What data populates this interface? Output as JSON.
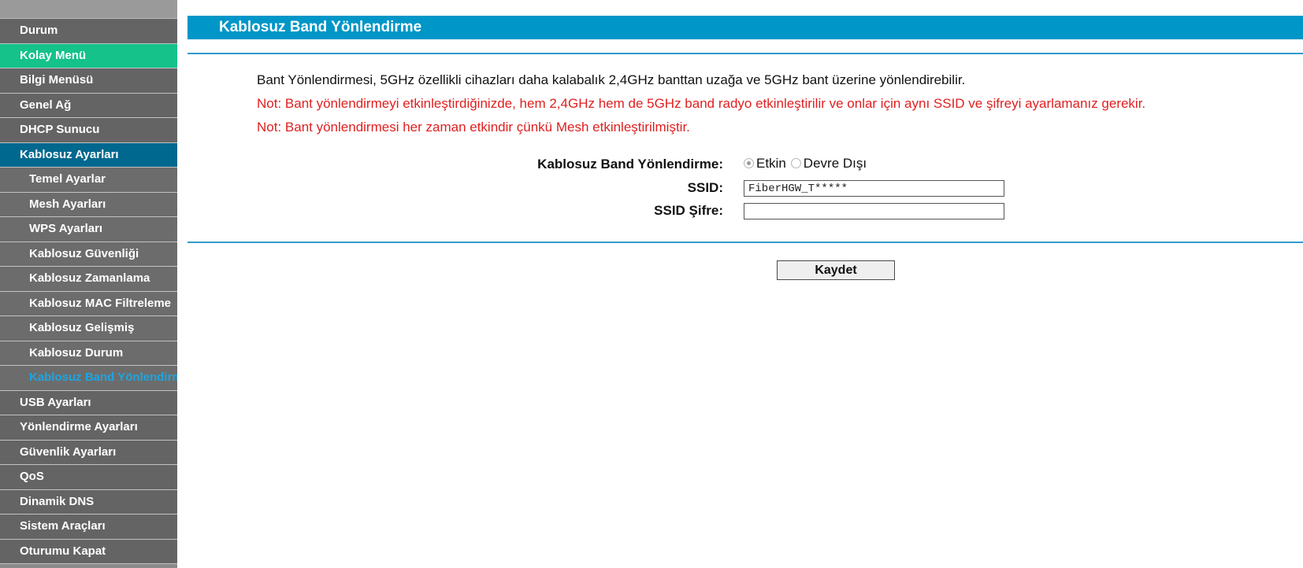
{
  "colors": {
    "sidebar_bg": "#646464",
    "active_parent": "#00688e",
    "quick_menu": "#14c28a",
    "active_sub_text": "#1ea5e0",
    "title_bar": "#0096c8",
    "note_red": "#e02020"
  },
  "sidebar": {
    "items": [
      {
        "label": "Durum"
      },
      {
        "label": "Kolay Menü"
      },
      {
        "label": "Bilgi Menüsü"
      },
      {
        "label": "Genel Ağ"
      },
      {
        "label": "DHCP Sunucu"
      },
      {
        "label": "Kablosuz Ayarları"
      },
      {
        "label": "Temel Ayarlar"
      },
      {
        "label": "Mesh Ayarları"
      },
      {
        "label": "WPS Ayarları"
      },
      {
        "label": "Kablosuz Güvenliği"
      },
      {
        "label": "Kablosuz Zamanlama"
      },
      {
        "label": "Kablosuz MAC Filtreleme"
      },
      {
        "label": "Kablosuz Gelişmiş"
      },
      {
        "label": "Kablosuz Durum"
      },
      {
        "label": "Kablosuz Band Yönlendirme"
      },
      {
        "label": "USB Ayarları"
      },
      {
        "label": "Yönlendirme Ayarları"
      },
      {
        "label": "Güvenlik Ayarları"
      },
      {
        "label": "QoS"
      },
      {
        "label": "Dinamik DNS"
      },
      {
        "label": "Sistem Araçları"
      },
      {
        "label": "Oturumu Kapat"
      }
    ]
  },
  "main": {
    "title": "Kablosuz Band Yönlendirme",
    "description": "Bant Yönlendirmesi, 5GHz özellikli cihazları daha kalabalık 2,4GHz banttan uzağa ve 5GHz bant üzerine yönlendirebilir.",
    "note1": "Not: Bant yönlendirmeyi etkinleştirdiğinizde, hem 2,4GHz hem de 5GHz band radyo etkinleştirilir ve onlar için aynı SSID ve şifreyi ayarlamanız gerekir.",
    "note2": "Not: Bant yönlendirmesi her zaman etkindir çünkü Mesh etkinleştirilmiştir.",
    "form": {
      "band_label": "Kablosuz Band Yönlendirme:",
      "option_enabled": "Etkin",
      "option_disabled": "Devre Dışı",
      "selected": "Etkin",
      "ssid_label": "SSID:",
      "ssid_value": "FiberHGW_T*****",
      "password_label": "SSID Şifre:",
      "password_value": ""
    },
    "save_label": "Kaydet"
  }
}
